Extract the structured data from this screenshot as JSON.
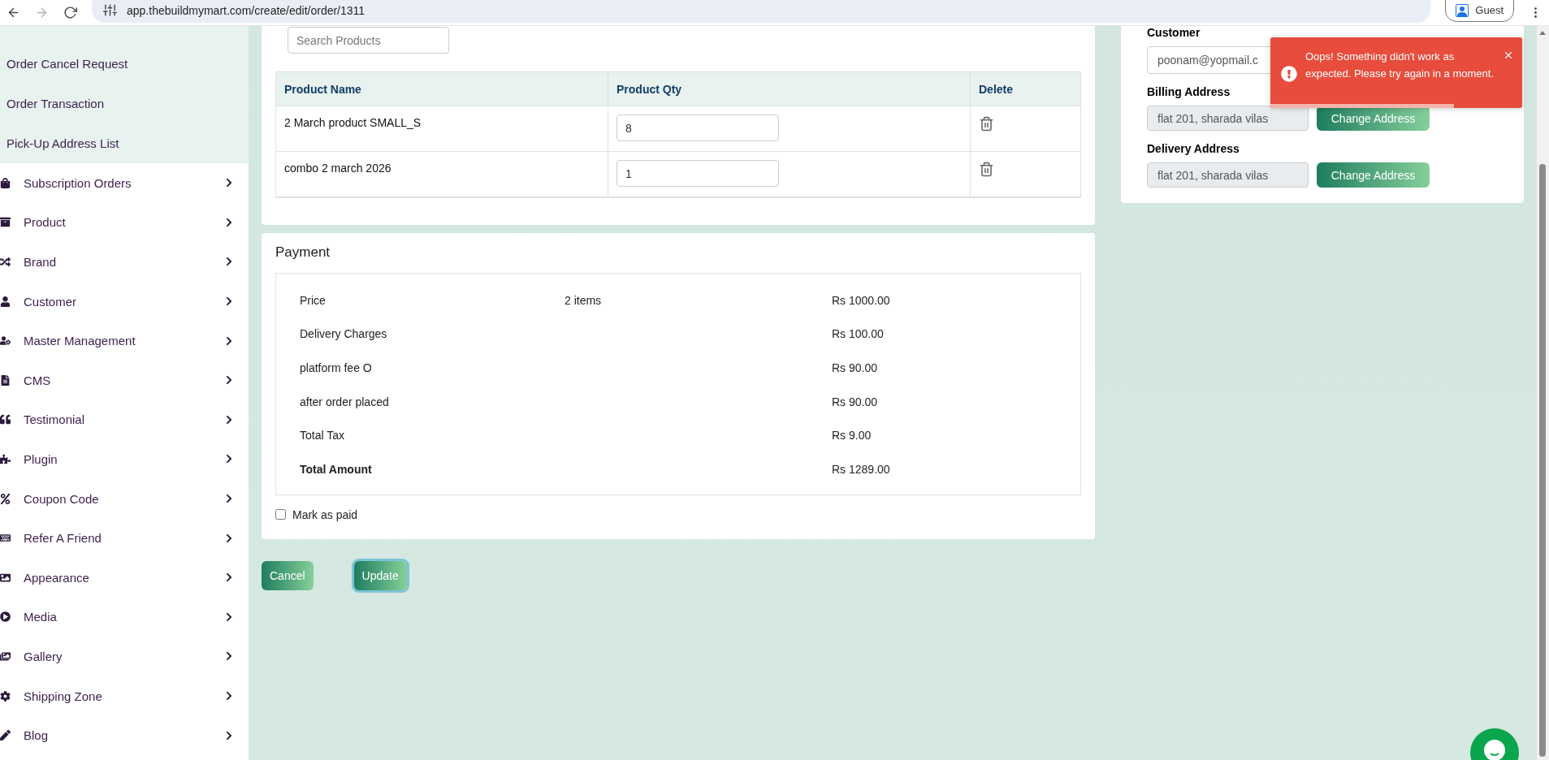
{
  "browser": {
    "url": "app.thebuildmymart.com/create/edit/order/1311",
    "profile": "Guest"
  },
  "sidebar": {
    "submenu": [
      {
        "label": "Order Cancel Request"
      },
      {
        "label": "Order Transaction"
      },
      {
        "label": "Pick-Up Address List"
      }
    ],
    "items": [
      {
        "label": "Subscription Orders"
      },
      {
        "label": "Product"
      },
      {
        "label": "Brand"
      },
      {
        "label": "Customer"
      },
      {
        "label": "Master Management"
      },
      {
        "label": "CMS"
      },
      {
        "label": "Testimonial"
      },
      {
        "label": "Plugin"
      },
      {
        "label": "Coupon Code"
      },
      {
        "label": "Refer A Friend"
      },
      {
        "label": "Appearance"
      },
      {
        "label": "Media"
      },
      {
        "label": "Gallery"
      },
      {
        "label": "Shipping Zone"
      },
      {
        "label": "Blog"
      }
    ]
  },
  "products": {
    "search": {
      "placeholder": "Search Products"
    },
    "columns": [
      "Product Name",
      "Product Qty",
      "Delete"
    ],
    "rows": [
      {
        "name": "2 March product SMALL_S",
        "qty": "8"
      },
      {
        "name": "combo 2 march 2026",
        "qty": "1"
      }
    ]
  },
  "payment": {
    "title": "Payment",
    "rows": [
      {
        "label": "Price",
        "note": "2 items",
        "amount": "Rs 1000.00",
        "total": false
      },
      {
        "label": "Delivery Charges",
        "amount": "Rs 100.00",
        "total": false
      },
      {
        "label": "platform fee O",
        "amount": "Rs 90.00",
        "total": false
      },
      {
        "label": "after order placed",
        "amount": "Rs 90.00",
        "total": false
      },
      {
        "label": "Total Tax",
        "amount": "Rs 9.00",
        "total": false
      },
      {
        "label": "Total Amount",
        "amount": "Rs 1289.00",
        "total": true
      }
    ],
    "mark_paid": {
      "label": "Mark as paid",
      "checked": false
    }
  },
  "actions": [
    {
      "label": "Cancel",
      "focused": false
    },
    {
      "label": "Update",
      "focused": true
    }
  ],
  "customer": {
    "label": "Customer",
    "email": "poonam@yopmail.c",
    "addresses": [
      {
        "label": "Billing Address",
        "value": "flat 201, sharada vilas",
        "button": "Change Address"
      },
      {
        "label": "Delivery Address",
        "value": "flat 201, sharada vilas",
        "button": "Change Address"
      }
    ]
  },
  "toast": {
    "message": "Oops! Something didn't work as expected. Please try again in a moment.",
    "level": 0.73
  }
}
